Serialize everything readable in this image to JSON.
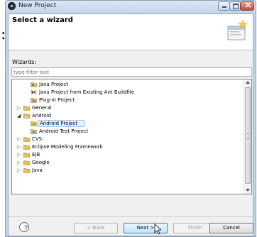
{
  "outer": {
    "fragment": ":"
  },
  "window": {
    "title": "New Project"
  },
  "banner": {
    "title": "Select a wizard"
  },
  "filter": {
    "label": "Wizards:",
    "placeholder": "type filter text"
  },
  "tree": [
    {
      "label": "Java Project",
      "icon": "java-project-icon"
    },
    {
      "label": "Java Project from Existing Ant Buildfile",
      "icon": "ant-icon"
    },
    {
      "label": "Plug-in Project",
      "icon": "plugin-project-icon"
    },
    {
      "label": "General",
      "icon": "folder-icon",
      "expanded": false
    },
    {
      "label": "Android",
      "icon": "folder-icon",
      "expanded": true
    },
    {
      "label": "Android Project",
      "icon": "android-project-icon",
      "selected": true
    },
    {
      "label": "Android Test Project",
      "icon": "android-test-project-icon"
    },
    {
      "label": "CVS",
      "icon": "folder-icon",
      "expanded": false
    },
    {
      "label": "Eclipse Modeling Framework",
      "icon": "folder-icon",
      "expanded": false
    },
    {
      "label": "EJB",
      "icon": "folder-icon",
      "expanded": false
    },
    {
      "label": "Google",
      "icon": "folder-icon",
      "expanded": false
    },
    {
      "label": "Java",
      "icon": "folder-icon",
      "expanded": false
    }
  ],
  "buttons": {
    "help": "?",
    "back": "< Back",
    "next": "Next >",
    "finish": "Finish",
    "cancel": "Cancel"
  },
  "colors": {
    "selection": "#e6f0fb",
    "folder": "#e8c05a",
    "titlebar": "#bfd3e9"
  }
}
